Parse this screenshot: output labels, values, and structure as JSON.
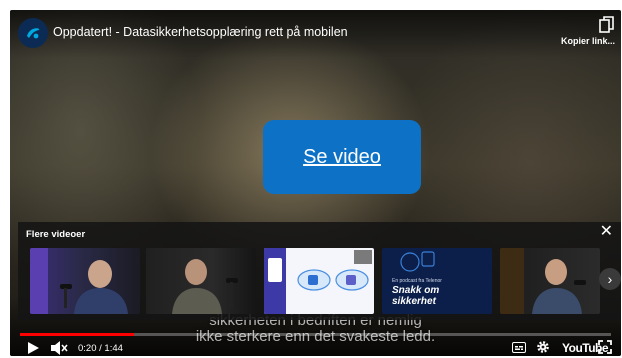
{
  "video": {
    "title": "Oppdatert! - Datasikkerhetsopplæring rett på mobilen",
    "channel_logo_icon": "telia-pebble-icon",
    "copy_link_label": "Kopier link...",
    "cta_label": "Se video",
    "subtitle_line1": "sikkerheten i bedriften er nemlig",
    "subtitle_line2": "ikke sterkere enn det svakeste ledd."
  },
  "more_videos": {
    "heading": "Flere videoer",
    "close_icon": "close-icon",
    "next_icon": "chevron-right-icon",
    "thumbnails": [
      {
        "kind": "podcast-studio-guest"
      },
      {
        "kind": "podcast-studio-guest"
      },
      {
        "kind": "teams-app-screen"
      },
      {
        "kind": "podcast-cover",
        "line1": "En podcast fra Telenor",
        "line2": "Snakk om",
        "line3": "sikkerhet"
      },
      {
        "kind": "podcast-studio-guest"
      }
    ]
  },
  "player": {
    "current_time": "0:20",
    "duration": "1:44",
    "progress": 0.1923,
    "brand": "YouTube",
    "accent": "#ff0000",
    "cta_color": "#0d72c6"
  }
}
